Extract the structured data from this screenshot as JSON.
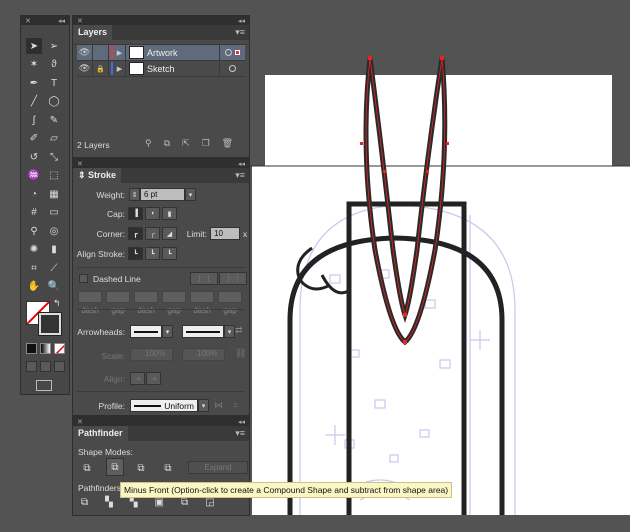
{
  "colors": {
    "artwork_layer": "#e33b3b",
    "sketch_layer": "#3f6ee0",
    "path": "#e22",
    "sketch": "#c6c8ee",
    "selection": "#5f6a7c"
  },
  "toolbar": {
    "tools": [
      "selection",
      "direct-selection",
      "magic-wand",
      "lasso",
      "pen",
      "type",
      "line",
      "ellipse",
      "paintbrush",
      "pencil",
      "blob-brush",
      "eraser",
      "rotate",
      "scale",
      "warp",
      "free-transform",
      "shape-builder",
      "perspective-grid",
      "mesh",
      "gradient",
      "eyedropper",
      "blend",
      "symbol-sprayer",
      "column-graph",
      "artboard",
      "slice",
      "hand",
      "zoom"
    ]
  },
  "layers": {
    "tab": "Layers",
    "rows": [
      {
        "name": "Artwork",
        "selected": true,
        "locked": false
      },
      {
        "name": "Sketch",
        "selected": false,
        "locked": true
      }
    ],
    "count": "2 Layers"
  },
  "stroke": {
    "tab": "Stroke",
    "weight_label": "Weight:",
    "weight": "6 pt",
    "cap_label": "Cap:",
    "corner_label": "Corner:",
    "limit_label": "Limit:",
    "limit": "10",
    "limit_unit": "x",
    "align_label": "Align Stroke:",
    "dashed_label": "Dashed Line",
    "dash_labels": [
      "dash",
      "gap",
      "dash",
      "gap",
      "dash",
      "gap"
    ],
    "arrowheads_label": "Arrowheads:",
    "scale_label": "Scale:",
    "scale1": "100%",
    "scale2": "100%",
    "align2_label": "Align:",
    "profile_label": "Profile:",
    "profile": "Uniform"
  },
  "pathfinder": {
    "tab": "Pathfinder",
    "shape_modes_label": "Shape Modes:",
    "expand": "Expand",
    "pathfinders_label": "Pathfinders:"
  },
  "tooltip": "Minus Front (Option-click to create a Compound Shape and subtract from shape area)"
}
